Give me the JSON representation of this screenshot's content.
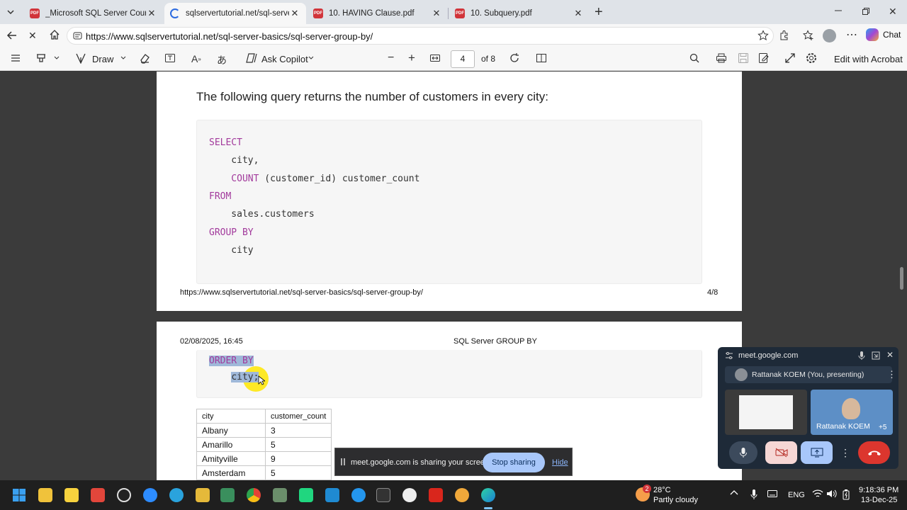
{
  "tabs": [
    {
      "title": "_Microsoft SQL Server Course Syll",
      "active": false
    },
    {
      "title": "sqlservertutorial.net/sql-server-ba",
      "active": true
    },
    {
      "title": "10. HAVING Clause.pdf",
      "active": false
    },
    {
      "title": "10. Subquery.pdf",
      "active": false
    }
  ],
  "address": {
    "url": "https://www.sqlservertutorial.net/sql-server-basics/sql-server-group-by/"
  },
  "pdf_toolbar": {
    "draw_label": "Draw",
    "copilot_label": "Ask Copilot",
    "page_number": "4",
    "page_total": "of 8",
    "edit_label": "Edit with Acrobat"
  },
  "browser": {
    "chat_label": "Chat"
  },
  "page1": {
    "intro": "The following query returns the number of customers in every city:",
    "code": {
      "l1": "SELECT",
      "l2": "    city,",
      "l3_kw": "    COUNT",
      "l3_rest": " (customer_id) customer_count",
      "l4": "FROM",
      "l5": "    sales.customers",
      "l6": "GROUP BY",
      "l7": "    city"
    },
    "footer_url": "https://www.sqlservertutorial.net/sql-server-basics/sql-server-group-by/",
    "footer_page": "4/8"
  },
  "page2": {
    "header_date": "02/08/2025, 16:45",
    "header_title": "SQL Server GROUP BY",
    "code": {
      "l1": "ORDER BY",
      "l2_indent": "    ",
      "l2": "city;"
    },
    "table": {
      "headers": [
        "city",
        "customer_count"
      ],
      "rows": [
        [
          "Albany",
          "3"
        ],
        [
          "Amarillo",
          "5"
        ],
        [
          "Amityville",
          "9"
        ],
        [
          "Amsterdam",
          "5"
        ]
      ]
    }
  },
  "meet": {
    "domain": "meet.google.com",
    "presenter": "Rattanak KOEM (You, presenting)",
    "tile_name": "Rattanak KOEM",
    "extra_count": "+5"
  },
  "sharebar": {
    "message": "meet.google.com is sharing your screen.",
    "stop": "Stop sharing",
    "hide": "Hide"
  },
  "taskbar": {
    "weather_temp": "28°C",
    "weather_desc": "Partly cloudy",
    "weather_badge": "2",
    "lang": "ENG",
    "time": "9:18:36 PM",
    "date": "13-Dec-25"
  }
}
